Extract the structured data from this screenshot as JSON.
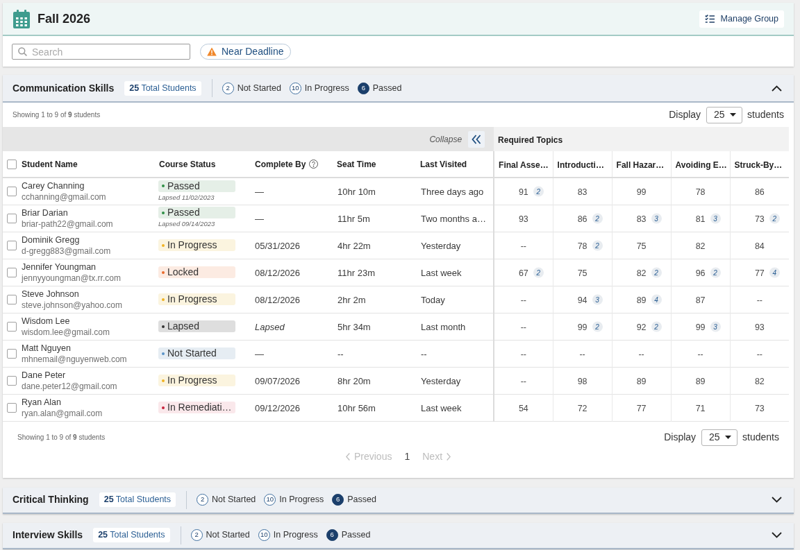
{
  "header": {
    "title": "Fall 2026",
    "manage_button": "Manage Group"
  },
  "toolbar": {
    "search": {
      "placeholder": "Search"
    },
    "filter_chip": "Near Deadline"
  },
  "sections": [
    {
      "title": "Communication Skills",
      "total": "**25** Total Students",
      "stats": [
        {
          "count": "2",
          "label": "Not Started",
          "kind": "outline"
        },
        {
          "count": "10",
          "label": "In Progress",
          "kind": "outline"
        },
        {
          "count": "6",
          "label": "Passed",
          "kind": "filled"
        }
      ],
      "expanded": true,
      "table": {
        "showing": "Showing 1 to 9 of **9** students",
        "display_label": "Display",
        "page_size": "25",
        "display_unit": "students",
        "collapse_label": "Collapse",
        "group_label": "Required Topics",
        "select_all_checked": false,
        "columns": [
          {
            "label": "Student Name",
            "help": false
          },
          {
            "label": "Course Status",
            "help": false
          },
          {
            "label": "Complete By",
            "help": true
          },
          {
            "label": "Seat Time",
            "help": false
          },
          {
            "label": "Last Visited",
            "help": false
          }
        ],
        "topic_columns": [
          "Final Asse…",
          "Introducti…",
          "Fall Hazar…",
          "Avoiding E…",
          "Struck-By…"
        ],
        "rows": [
          {
            "checked": false,
            "name": "Carey Channing",
            "email": "cchanning@gmail.com",
            "status": {
              "label": "Passed",
              "kind": "passed",
              "note": "Lapsed 11/02/2023"
            },
            "complete_by": "—",
            "complete_by_italic": false,
            "seat_time": "10hr 10m",
            "last_visited": "Three days ago",
            "scores": [
              {
                "value": "91",
                "attempts": "2"
              },
              {
                "value": "83"
              },
              {
                "value": "99"
              },
              {
                "value": "78"
              },
              {
                "value": "86"
              }
            ]
          },
          {
            "checked": false,
            "name": "Briar Darian",
            "email": "briar-path22@gmail.com",
            "status": {
              "label": "Passed",
              "kind": "passed",
              "note": "Lapsed 09/14/2023"
            },
            "complete_by": "—",
            "complete_by_italic": false,
            "seat_time": "11hr 5m",
            "last_visited": "Two months a…",
            "scores": [
              {
                "value": "93"
              },
              {
                "value": "86",
                "attempts": "2"
              },
              {
                "value": "83",
                "attempts": "3"
              },
              {
                "value": "81",
                "attempts": "3"
              },
              {
                "value": "73",
                "attempts": "2"
              }
            ]
          },
          {
            "checked": false,
            "name": "Dominik Gregg",
            "email": "d-gregg883@gmail.com",
            "status": {
              "label": "In Progress",
              "kind": "in_progress"
            },
            "complete_by": "05/31/2026",
            "complete_by_italic": false,
            "seat_time": "4hr 22m",
            "last_visited": "Yesterday",
            "scores": [
              {
                "value": "--"
              },
              {
                "value": "78",
                "attempts": "2"
              },
              {
                "value": "75"
              },
              {
                "value": "82"
              },
              {
                "value": "84"
              }
            ]
          },
          {
            "checked": false,
            "name": "Jennifer Youngman",
            "email": "jennyyoungman@tx.rr.com",
            "status": {
              "label": "Locked",
              "kind": "locked"
            },
            "complete_by": "08/12/2026",
            "complete_by_italic": false,
            "seat_time": "11hr 23m",
            "last_visited": "Last week",
            "scores": [
              {
                "value": "67",
                "attempts": "2"
              },
              {
                "value": "75"
              },
              {
                "value": "82",
                "attempts": "2"
              },
              {
                "value": "96",
                "attempts": "2"
              },
              {
                "value": "77",
                "attempts": "4"
              }
            ]
          },
          {
            "checked": false,
            "name": "Steve Johnson",
            "email": "steve.johnson@yahoo.com",
            "status": {
              "label": "In Progress",
              "kind": "in_progress"
            },
            "complete_by": "08/12/2026",
            "complete_by_italic": false,
            "seat_time": "2hr 2m",
            "last_visited": "Today",
            "scores": [
              {
                "value": "--"
              },
              {
                "value": "94",
                "attempts": "3"
              },
              {
                "value": "89",
                "attempts": "4"
              },
              {
                "value": "87"
              },
              {
                "value": "--"
              }
            ]
          },
          {
            "checked": false,
            "name": "Wisdom Lee",
            "email": "wisdom.lee@gmail.com",
            "status": {
              "label": "Lapsed",
              "kind": "lapsed"
            },
            "complete_by": "Lapsed",
            "complete_by_italic": true,
            "seat_time": "5hr 34m",
            "last_visited": "Last month",
            "scores": [
              {
                "value": "--"
              },
              {
                "value": "99",
                "attempts": "2"
              },
              {
                "value": "92",
                "attempts": "2"
              },
              {
                "value": "99",
                "attempts": "3"
              },
              {
                "value": "93"
              }
            ]
          },
          {
            "checked": false,
            "name": "Matt Nguyen",
            "email": "mhnemail@nguyenweb.com",
            "status": {
              "label": "Not Started",
              "kind": "not_started"
            },
            "complete_by": "—",
            "complete_by_italic": false,
            "seat_time": "--",
            "last_visited": "--",
            "scores": [
              {
                "value": "--"
              },
              {
                "value": "--"
              },
              {
                "value": "--"
              },
              {
                "value": "--"
              },
              {
                "value": "--"
              }
            ]
          },
          {
            "checked": false,
            "name": "Dane Peter",
            "email": "dane.peter12@gmail.com",
            "status": {
              "label": "In Progress",
              "kind": "in_progress"
            },
            "complete_by": "09/07/2026",
            "complete_by_italic": false,
            "seat_time": "8hr 20m",
            "last_visited": "Yesterday",
            "scores": [
              {
                "value": "--"
              },
              {
                "value": "98"
              },
              {
                "value": "89"
              },
              {
                "value": "89"
              },
              {
                "value": "82"
              }
            ]
          },
          {
            "checked": false,
            "name": "Ryan Alan",
            "email": "ryan.alan@gmail.com",
            "status": {
              "label": "In Remediati…",
              "kind": "remediation"
            },
            "complete_by": "09/12/2026",
            "complete_by_italic": false,
            "seat_time": "10hr 56m",
            "last_visited": "Last week",
            "scores": [
              {
                "value": "54"
              },
              {
                "value": "72"
              },
              {
                "value": "77"
              },
              {
                "value": "71"
              },
              {
                "value": "73"
              }
            ]
          }
        ],
        "footer": {
          "showing": "Showing 1 to 9 of **9** students",
          "display_label": "Display",
          "page_size": "25",
          "display_unit": "students"
        },
        "pagination": {
          "previous": "Previous",
          "previous_disabled": true,
          "pages": [
            {
              "label": "1",
              "selected": true
            }
          ],
          "next": "Next",
          "next_disabled": true
        }
      }
    },
    {
      "title": "Critical Thinking",
      "total": "**25** Total Students",
      "stats": [
        {
          "count": "2",
          "label": "Not Started",
          "kind": "outline"
        },
        {
          "count": "10",
          "label": "In Progress",
          "kind": "outline"
        },
        {
          "count": "6",
          "label": "Passed",
          "kind": "filled"
        }
      ],
      "expanded": false
    },
    {
      "title": "Interview Skills",
      "total": "**25** Total Students",
      "stats": [
        {
          "count": "2",
          "label": "Not Started",
          "kind": "outline"
        },
        {
          "count": "10",
          "label": "In Progress",
          "kind": "outline"
        },
        {
          "count": "6",
          "label": "Passed",
          "kind": "filled"
        }
      ],
      "expanded": false
    }
  ]
}
